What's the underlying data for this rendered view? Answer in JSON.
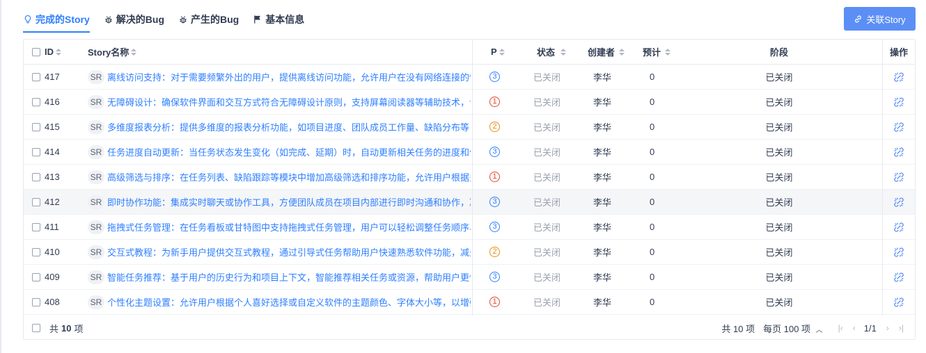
{
  "tabs": [
    {
      "label": "完成的Story",
      "icon": "lightbulb-icon",
      "active": true
    },
    {
      "label": "解决的Bug",
      "icon": "bug-icon",
      "active": false
    },
    {
      "label": "产生的Bug",
      "icon": "bug-icon",
      "active": false
    },
    {
      "label": "基本信息",
      "icon": "flag-icon",
      "active": false
    }
  ],
  "link_button": {
    "label": "关联Story",
    "icon": "link-icon"
  },
  "columns": {
    "id": "ID",
    "name": "Story名称",
    "pri": "P",
    "status": "状态",
    "creator": "创建者",
    "estimate": "预计",
    "stage": "阶段",
    "actions": "操作"
  },
  "colors": {
    "accent": "#2e7fff",
    "pri1": "#e3472c",
    "pri2": "#e88e12",
    "pri3": "#2e7fff"
  },
  "rows": [
    {
      "id": "417",
      "tag": "SR",
      "name": "离线访问支持：对于需要频繁外出的用户，提供离线访问功能，允许用户在没有网络连接的情况下",
      "pri": "3",
      "status": "已关闭",
      "creator": "李华",
      "estimate": "0",
      "stage": "已关闭",
      "action_icon": "unlink-icon"
    },
    {
      "id": "416",
      "tag": "SR",
      "name": "无障碍设计：确保软件界面和交互方式符合无障碍设计原则，支持屏幕阅读器等辅助技术，让",
      "pri": "1",
      "status": "已关闭",
      "creator": "李华",
      "estimate": "0",
      "stage": "已关闭",
      "action_icon": "unlink-icon"
    },
    {
      "id": "415",
      "tag": "SR",
      "name": "多维度报表分析：提供多维度的报表分析功能，如项目进度、团队成员工作量、缺陷分布等，",
      "pri": "2",
      "status": "已关闭",
      "creator": "李华",
      "estimate": "0",
      "stage": "已关闭",
      "action_icon": "unlink-icon"
    },
    {
      "id": "414",
      "tag": "SR",
      "name": "任务进度自动更新：当任务状态发生变化（如完成、延期）时，自动更新相关任务的进度和依",
      "pri": "3",
      "status": "已关闭",
      "creator": "李华",
      "estimate": "0",
      "stage": "已关闭",
      "action_icon": "unlink-icon"
    },
    {
      "id": "413",
      "tag": "SR",
      "name": "高级筛选与排序：在任务列表、缺陷跟踪等模块中增加高级筛选和排序功能，允许用户根据多",
      "pri": "1",
      "status": "已关闭",
      "creator": "李华",
      "estimate": "0",
      "stage": "已关闭",
      "action_icon": "unlink-icon"
    },
    {
      "id": "412",
      "tag": "SR",
      "name": "即时协作功能：集成实时聊天或协作工具，方便团队成员在项目内部进行即时沟通和协作，减",
      "pri": "3",
      "status": "已关闭",
      "creator": "李华",
      "estimate": "0",
      "stage": "已关闭",
      "action_icon": "unlink-icon"
    },
    {
      "id": "411",
      "tag": "SR",
      "name": "拖拽式任务管理：在任务看板或甘特图中支持拖拽式任务管理，用户可以轻松调整任务顺序、",
      "pri": "3",
      "status": "已关闭",
      "creator": "李华",
      "estimate": "0",
      "stage": "已关闭",
      "action_icon": "unlink-icon"
    },
    {
      "id": "410",
      "tag": "SR",
      "name": "交互式教程：为新手用户提供交互式教程，通过引导式任务帮助用户快速熟悉软件功能，减少",
      "pri": "2",
      "status": "已关闭",
      "creator": "李华",
      "estimate": "0",
      "stage": "已关闭",
      "action_icon": "unlink-icon"
    },
    {
      "id": "409",
      "tag": "SR",
      "name": "智能任务推荐：基于用户的历史行为和项目上下文，智能推荐相关任务或资源，帮助用户更快",
      "pri": "3",
      "status": "已关闭",
      "creator": "李华",
      "estimate": "0",
      "stage": "已关闭",
      "action_icon": "unlink-icon"
    },
    {
      "id": "408",
      "tag": "SR",
      "name": "个性化主题设置：允许用户根据个人喜好选择或自定义软件的主题颜色、字体大小等，以增强",
      "pri": "1",
      "status": "已关闭",
      "creator": "李华",
      "estimate": "0",
      "stage": "已关闭",
      "action_icon": "unlink-icon"
    }
  ],
  "highlighted_row": 5,
  "footer": {
    "total_prefix": "共",
    "total_count": "10",
    "total_suffix": "项",
    "pager_total": "共 10 项",
    "per_page": "每页 100 项",
    "page": "1/1"
  }
}
